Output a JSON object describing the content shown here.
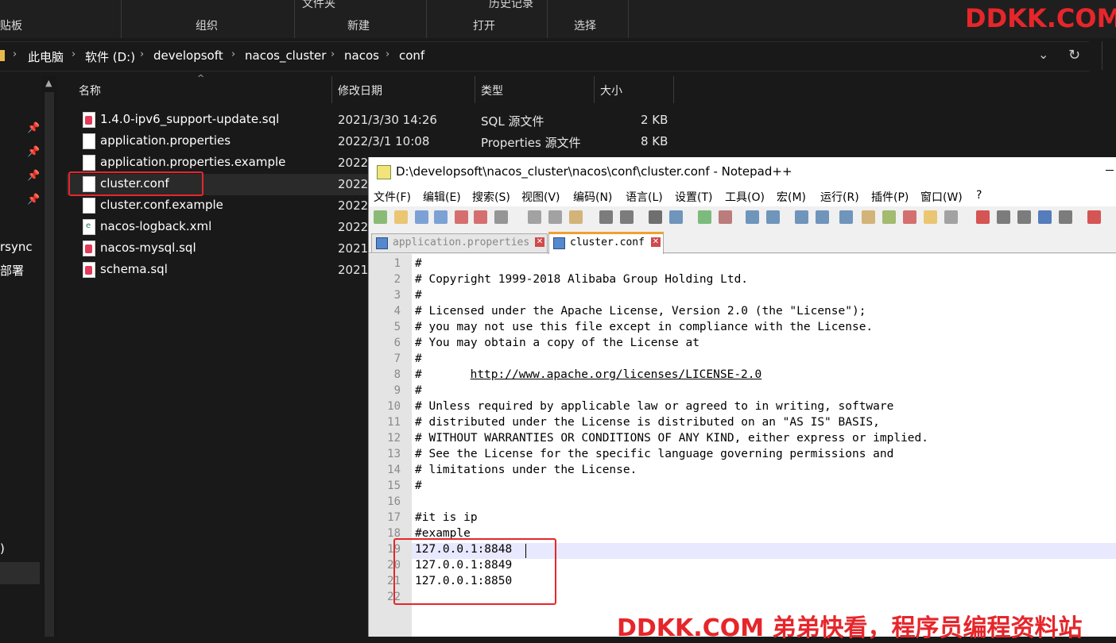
{
  "ribbon": {
    "top_folder": "文件夹",
    "top_history": "历史记录",
    "clipboard": "贴板",
    "organize": "组织",
    "new": "新建",
    "open": "打开",
    "select": "选择"
  },
  "address": {
    "crumbs": [
      "此电脑",
      "软件 (D:)",
      "developsoft",
      "nacos_cluster",
      "nacos",
      "conf"
    ],
    "dropdown_icon": "chevron-down-icon",
    "refresh_icon": "refresh-icon"
  },
  "sidebar": {
    "items": [
      "rsync",
      "部署",
      ")"
    ]
  },
  "columns": {
    "name": "名称",
    "modified": "修改日期",
    "type": "类型",
    "size": "大小"
  },
  "files": [
    {
      "name": "1.4.0-ipv6_support-update.sql",
      "date": "2021/3/30 14:26",
      "type": "SQL 源文件",
      "size": "2 KB",
      "icon": "sql"
    },
    {
      "name": "application.properties",
      "date": "2022/3/1 10:08",
      "type": "Properties 源文件",
      "size": "8 KB",
      "icon": "file"
    },
    {
      "name": "application.properties.example",
      "date": "2022",
      "type": "",
      "size": "",
      "icon": "file"
    },
    {
      "name": "cluster.conf",
      "date": "2022",
      "type": "",
      "size": "",
      "icon": "file"
    },
    {
      "name": "cluster.conf.example",
      "date": "2022",
      "type": "",
      "size": "",
      "icon": "file"
    },
    {
      "name": "nacos-logback.xml",
      "date": "2022",
      "type": "",
      "size": "",
      "icon": "xml"
    },
    {
      "name": "nacos-mysql.sql",
      "date": "2021",
      "type": "",
      "size": "",
      "icon": "sql"
    },
    {
      "name": "schema.sql",
      "date": "2021",
      "type": "",
      "size": "",
      "icon": "sql"
    }
  ],
  "notepad": {
    "title": "D:\\developsoft\\nacos_cluster\\nacos\\conf\\cluster.conf - Notepad++",
    "menu": [
      "文件(F)",
      "编辑(E)",
      "搜索(S)",
      "视图(V)",
      "编码(N)",
      "语言(L)",
      "设置(T)",
      "工具(O)",
      "宏(M)",
      "运行(R)",
      "插件(P)",
      "窗口(W)",
      "?"
    ],
    "tabs": [
      {
        "label": "application.properties"
      },
      {
        "label": "cluster.conf"
      }
    ],
    "lines": [
      "#",
      "# Copyright 1999-2018 Alibaba Group Holding Ltd.",
      "#",
      "# Licensed under the Apache License, Version 2.0 (the \"License\");",
      "# you may not use this file except in compliance with the License.",
      "# You may obtain a copy of the License at",
      "#",
      "#      ",
      "#",
      "# Unless required by applicable law or agreed to in writing, software",
      "# distributed under the License is distributed on an \"AS IS\" BASIS,",
      "# WITHOUT WARRANTIES OR CONDITIONS OF ANY KIND, either express or implied.",
      "# See the License for the specific language governing permissions and",
      "# limitations under the License.",
      "#",
      "",
      "#it is ip",
      "#example",
      "127.0.0.1:8848",
      "127.0.0.1:8849",
      "127.0.0.1:8850",
      ""
    ],
    "line_numbers": [
      "1",
      "2",
      "3",
      "4",
      "5",
      "6",
      "7",
      "8",
      "9",
      "10",
      "11",
      "12",
      "13",
      "14",
      "15",
      "16",
      "17",
      "18",
      "19",
      "20",
      "21",
      "22"
    ],
    "license_url": "http://www.apache.org/licenses/LICENSE-2.0"
  },
  "watermark_top": "DDKK.COM",
  "watermark_bottom": "DDKK.COM 弟弟快看，程序员编程资料站",
  "colors": {
    "highlight_red": "#e6262b",
    "explorer_bg": "#191919"
  }
}
